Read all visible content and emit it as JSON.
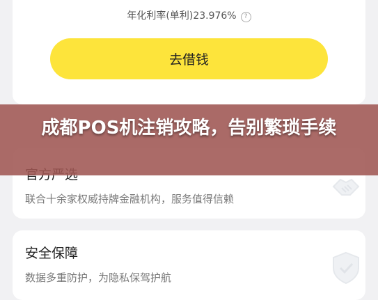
{
  "loan_card": {
    "rate_text": "年化利率(单利)23.976%",
    "help_icon": "question-circle-icon",
    "borrow_button": "去借钱"
  },
  "features": [
    {
      "title": "官方严选",
      "desc": "联合十余家权威持牌金融机构，服务值得信赖",
      "icon": "handshake-icon"
    },
    {
      "title": "安全保障",
      "desc": "数据多重防护，为隐私保驾护航",
      "icon": "shield-check-icon"
    }
  ],
  "overlay": {
    "title": "成都POS机注销攻略，告别繁琐手续"
  },
  "colors": {
    "button_yellow": "#fde43b",
    "banner": "#9f5653",
    "background": "#f1f1f3"
  }
}
